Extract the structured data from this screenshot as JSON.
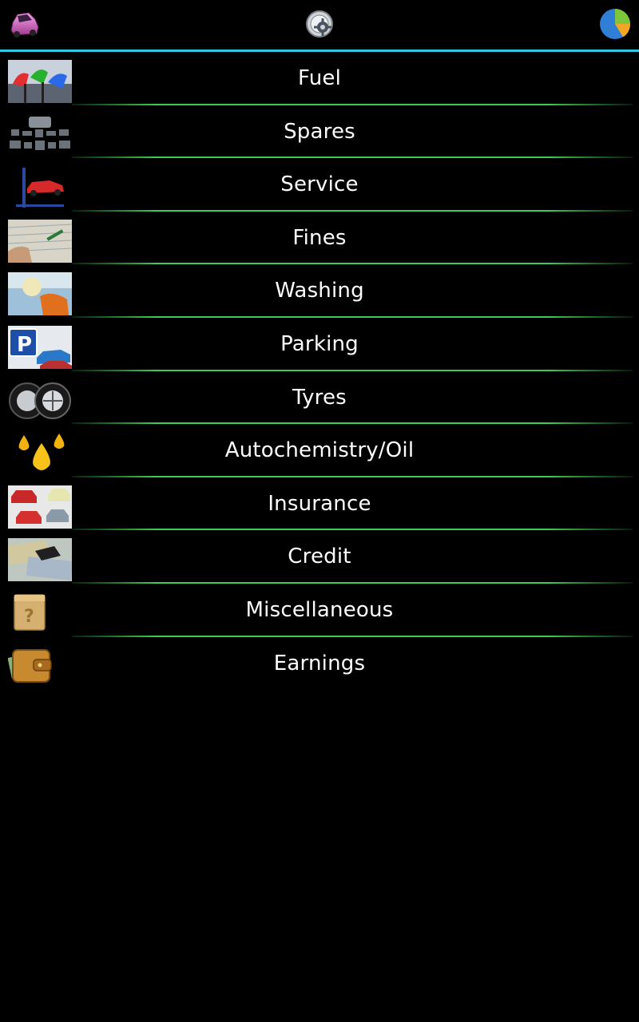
{
  "header": {
    "left_icon": "car-icon",
    "center_icon": "gear-settings-icon",
    "right_icon": "pie-chart-icon"
  },
  "colors": {
    "accent_line": "#2ec8e0",
    "separator": "#3ecb52",
    "background": "#000000",
    "text": "#ffffff"
  },
  "categories": [
    {
      "label": "Fuel",
      "icon": "fuel-pump-icon"
    },
    {
      "label": "Spares",
      "icon": "spare-parts-icon"
    },
    {
      "label": "Service",
      "icon": "car-lift-icon"
    },
    {
      "label": "Fines",
      "icon": "fine-ticket-icon"
    },
    {
      "label": "Washing",
      "icon": "car-wash-icon"
    },
    {
      "label": "Parking",
      "icon": "parking-icon"
    },
    {
      "label": "Tyres",
      "icon": "tyres-icon"
    },
    {
      "label": "Autochemistry/Oil",
      "icon": "oil-drops-icon"
    },
    {
      "label": "Insurance",
      "icon": "insurance-cars-icon"
    },
    {
      "label": "Credit",
      "icon": "money-key-icon"
    },
    {
      "label": "Miscellaneous",
      "icon": "mystery-box-icon"
    },
    {
      "label": "Earnings",
      "icon": "wallet-icon"
    }
  ]
}
